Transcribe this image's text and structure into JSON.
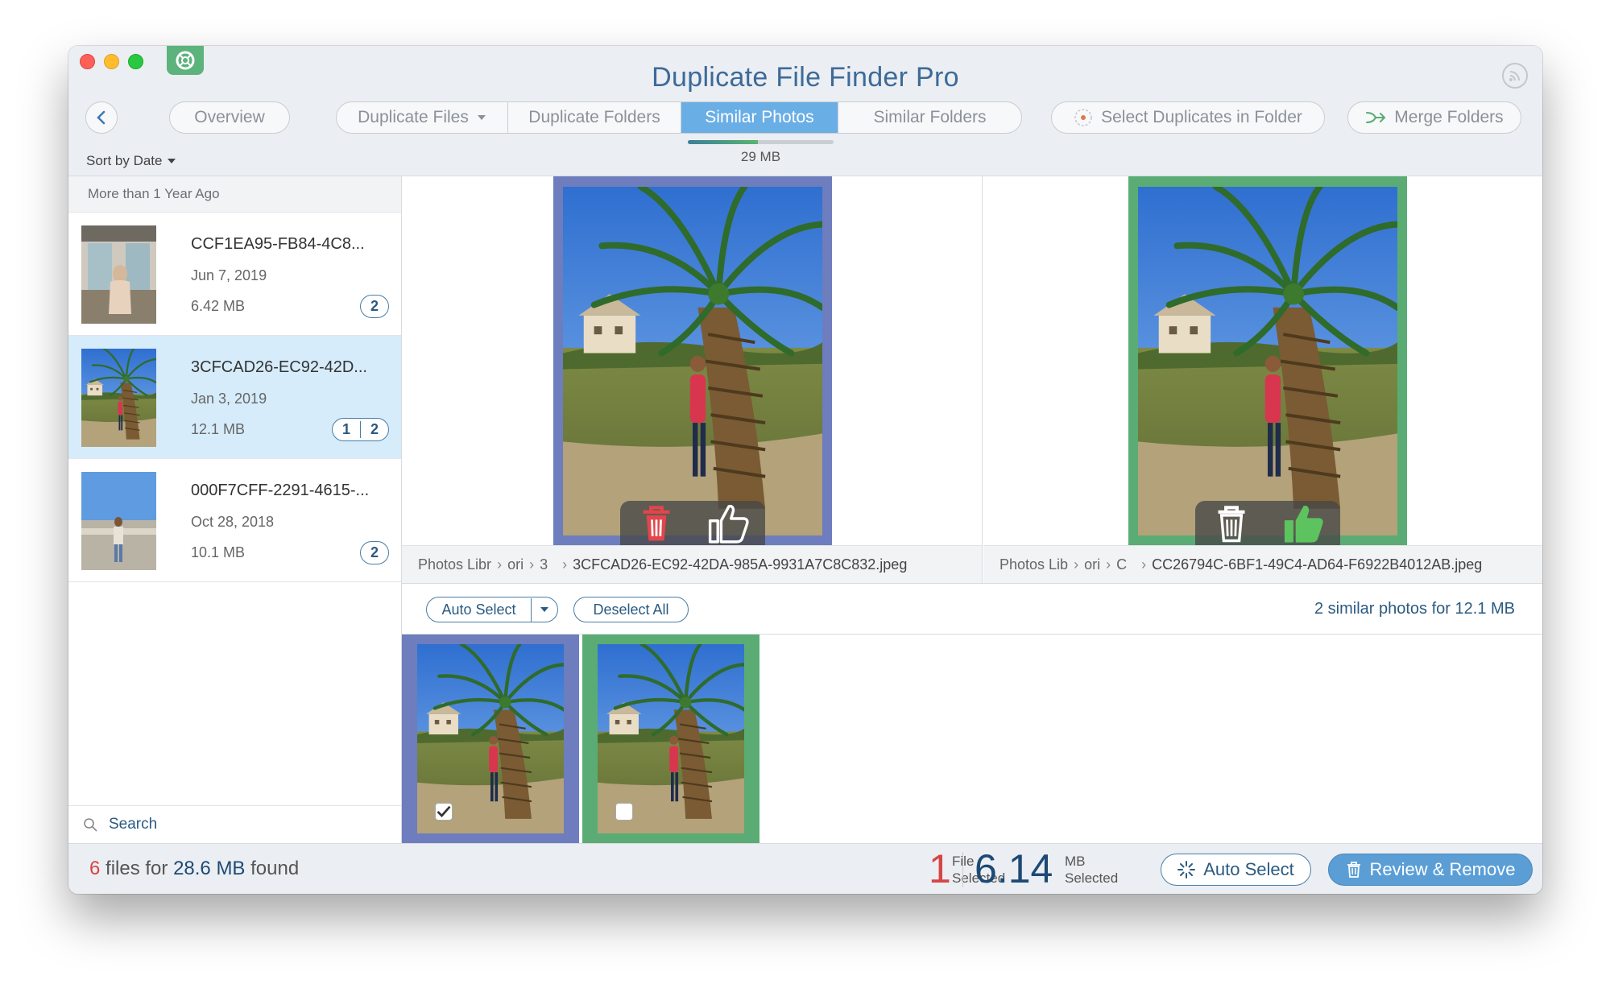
{
  "window": {
    "title": "Duplicate File Finder Pro"
  },
  "toolbar": {
    "overview_label": "Overview",
    "tabs": [
      {
        "label": "Duplicate Files",
        "active": false,
        "has_dropdown": true
      },
      {
        "label": "Duplicate Folders",
        "active": false
      },
      {
        "label": "Similar Photos",
        "active": true
      },
      {
        "label": "Similar Folders",
        "active": false
      }
    ],
    "select_duplicates_label": "Select Duplicates in Folder",
    "merge_folders_label": "Merge Folders",
    "scan_size_label": "29 MB",
    "scan_progress": 0.48
  },
  "sidebar": {
    "sort_label": "Sort by Date",
    "group_header": "More than 1 Year Ago",
    "items": [
      {
        "name": "CCF1EA95-FB84-4C8...",
        "date": "Jun 7, 2019",
        "size": "6.42 MB",
        "badges": [
          "2"
        ],
        "selected": false
      },
      {
        "name": "3CFCAD26-EC92-42D...",
        "date": "Jan 3, 2019",
        "size": "12.1 MB",
        "badges": [
          "1",
          "2"
        ],
        "selected": true
      },
      {
        "name": "000F7CFF-2291-4615-...",
        "date": "Oct 28, 2018",
        "size": "10.1 MB",
        "badges": [
          "2"
        ],
        "selected": false
      }
    ],
    "search_placeholder": "Search"
  },
  "compare": {
    "left": {
      "path": [
        "Photos Libr",
        "ori",
        "3"
      ],
      "filename": "3CFCAD26-EC92-42DA-985A-9931A7C8C832.jpeg"
    },
    "right": {
      "path": [
        "Photos Lib",
        "ori",
        "C"
      ],
      "filename": "CC26794C-6BF1-49C4-AD64-F6922B4012AB.jpeg"
    }
  },
  "controls": {
    "auto_select_label": "Auto Select",
    "deselect_all_label": "Deselect All",
    "summary": "2 similar photos for 12.1 MB"
  },
  "thumbnails": [
    {
      "checked": true,
      "frame_color": "#6d7dbd"
    },
    {
      "checked": false,
      "frame_color": "#5aac74"
    }
  ],
  "footer": {
    "files_count": "6",
    "files_text": "files for",
    "total_size": "28.6 MB",
    "found_text": "found",
    "selected_count": "1",
    "selected_count_label_1": "File",
    "selected_count_label_2": "Selected",
    "selected_size": "6.14",
    "selected_size_unit": "MB",
    "selected_size_label": "Selected",
    "auto_select_label": "Auto Select",
    "review_remove_label": "Review & Remove"
  },
  "colors": {
    "accent_blue": "#6aaee6",
    "keep_green": "#5aac74",
    "delete_blue_frame": "#6d7dbd",
    "danger_red": "#d64545"
  },
  "icons": {
    "back": "chevron-left-icon",
    "rss": "rss-icon",
    "app_logo": "lifebuoy-icon",
    "select_duplicates": "target-icon",
    "merge": "merge-arrow-icon",
    "search": "search-icon",
    "delete": "trash-icon",
    "keep": "thumbs-up-icon",
    "auto_select": "sparkle-icon",
    "review": "trash-icon"
  }
}
